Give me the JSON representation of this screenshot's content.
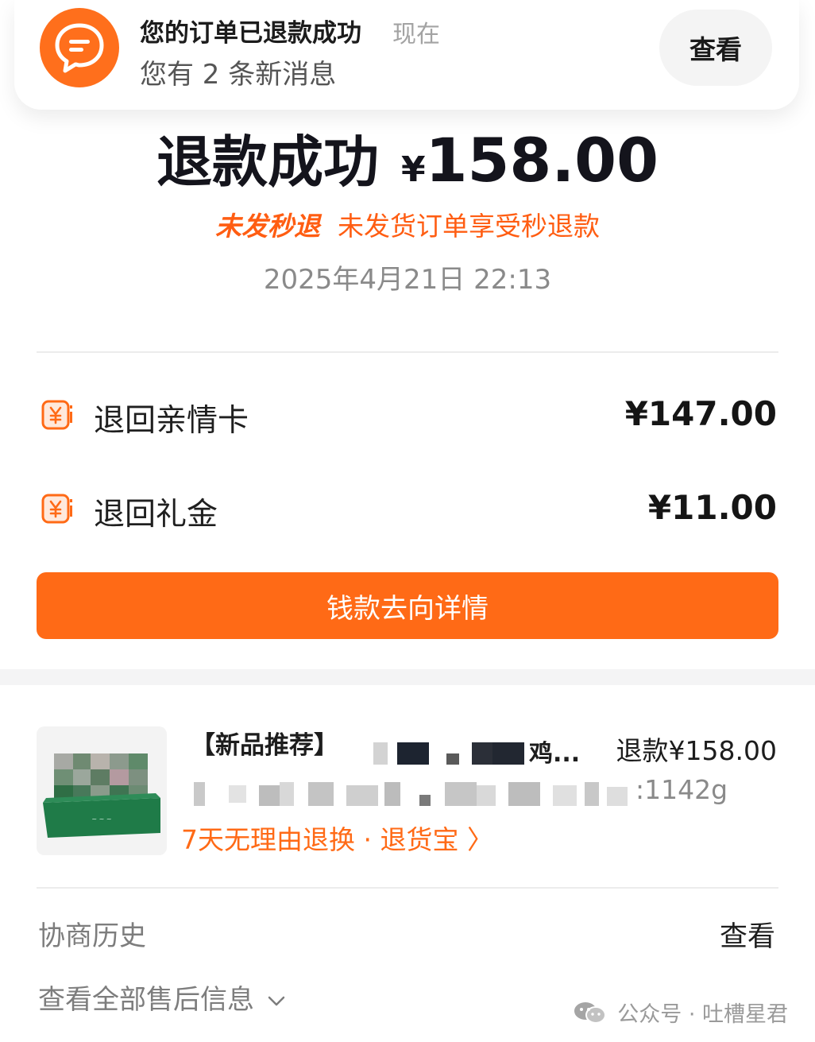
{
  "notification": {
    "title": "您的订单已退款成功",
    "time": "现在",
    "message": "您有 2 条新消息",
    "view_button": "查看",
    "icon": "chat-bubble-icon",
    "icon_color": "#ff6f1c"
  },
  "refund": {
    "status": "退款成功",
    "currency": "¥",
    "amount": "158.00",
    "promo_tag": "未发秒退",
    "promo_text": "未发货订单享受秒退款",
    "date": "2025年4月21日 22:13"
  },
  "breakdown": [
    {
      "label": "退回亲情卡",
      "amount": "¥147.00",
      "icon": "yuan-card-icon"
    },
    {
      "label": "退回礼金",
      "amount": "¥11.00",
      "icon": "yuan-card-icon"
    }
  ],
  "money_flow_button": "钱款去向详情",
  "accent_color": "#ff6a16",
  "product": {
    "name": "【新品推荐】",
    "name_suffix": "鸡...",
    "spec_suffix": ":1142g",
    "refund": "退款¥158.00",
    "service": "7天无理由退换 · 退货宝 〉"
  },
  "footer": {
    "negotiation_label": "协商历史",
    "negotiation_view": "查看",
    "all_after_sales": "查看全部售后信息"
  },
  "watermark": {
    "text": "公众号 · 吐槽星君",
    "icon": "wechat-icon"
  }
}
